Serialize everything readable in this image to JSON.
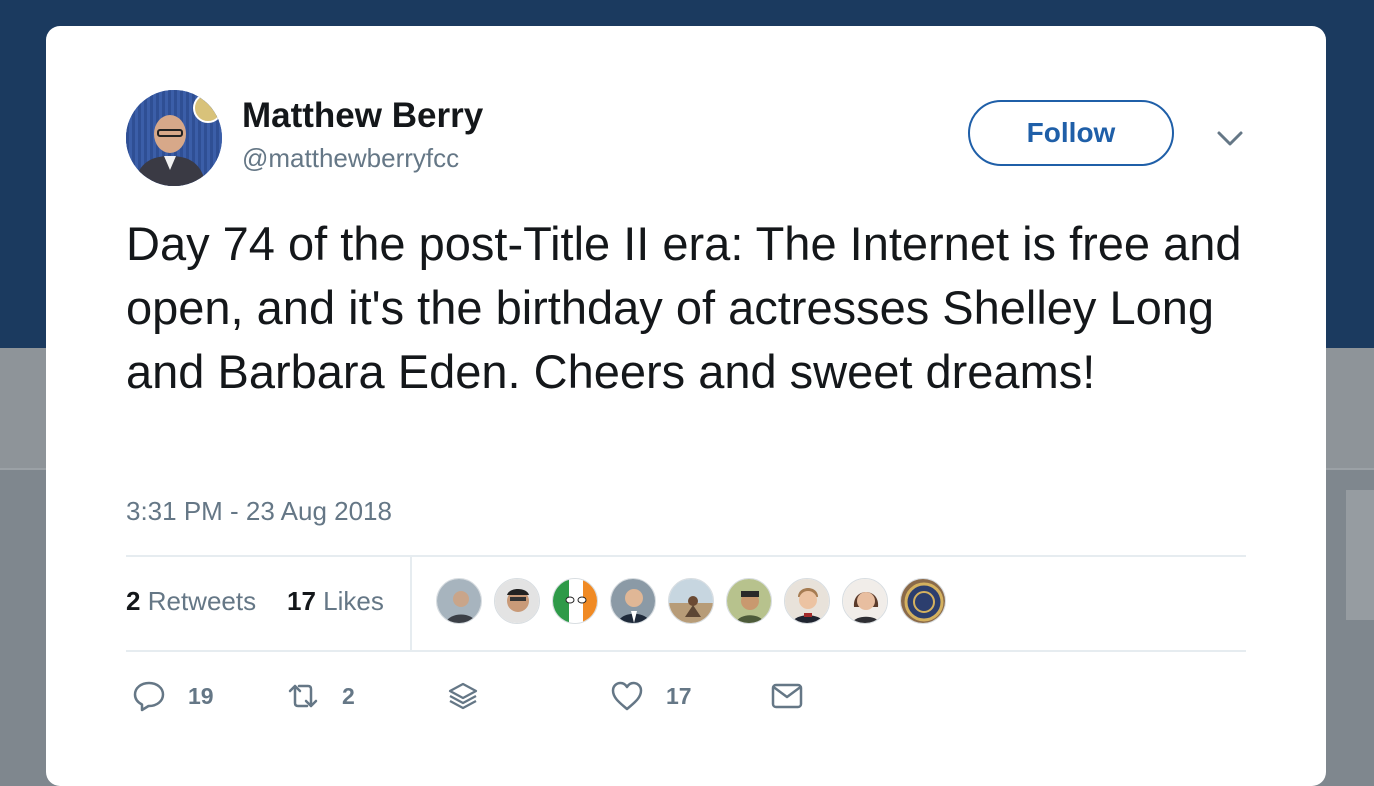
{
  "user": {
    "name": "Matthew Berry",
    "handle": "@matthewberryfcc",
    "follow_label": "Follow"
  },
  "tweet": {
    "text": "Day 74 of the post-Title II era:  The Internet is free and open, and it's the birthday of actresses Shelley Long and Barbara Eden. Cheers and sweet dreams!",
    "timestamp": "3:31 PM - 23 Aug 2018"
  },
  "stats": {
    "retweets_count": "2",
    "retweets_label": "Retweets",
    "likes_count": "17",
    "likes_label": "Likes"
  },
  "liker_avatars": [
    "avatar-1",
    "avatar-2",
    "avatar-3",
    "avatar-4",
    "avatar-5",
    "avatar-6",
    "avatar-7",
    "avatar-8",
    "avatar-9"
  ],
  "actions": {
    "reply_count": "19",
    "retweet_count": "2",
    "like_count": "17"
  },
  "colors": {
    "accent": "#1f5fa8",
    "header_bg": "#1b3a5f",
    "text": "#14171a",
    "secondary_text": "#657786"
  }
}
